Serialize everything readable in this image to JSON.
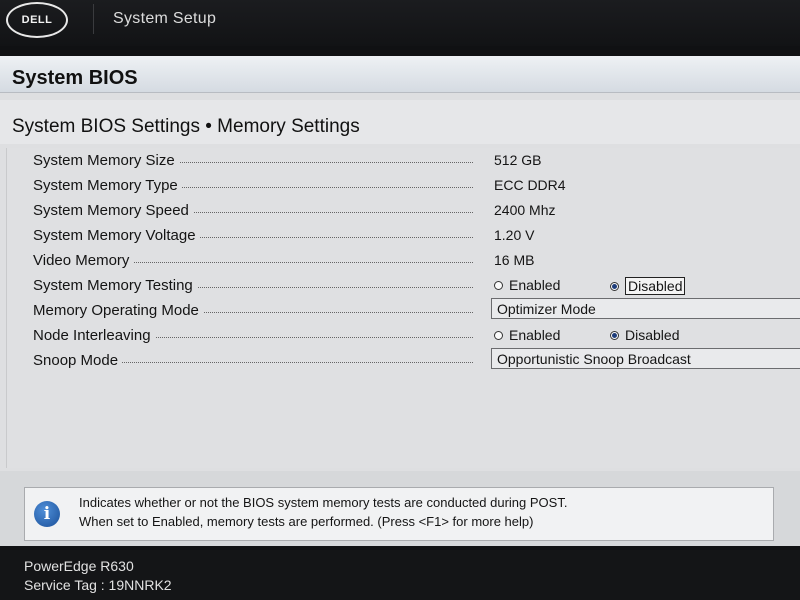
{
  "header": {
    "logo_text": "DELL",
    "app_title": "System Setup"
  },
  "section": {
    "title": "System BIOS"
  },
  "page": {
    "title": "System BIOS Settings • Memory Settings"
  },
  "settings": [
    {
      "label": "System Memory Size",
      "value": "512 GB"
    },
    {
      "label": "System Memory Type",
      "value": "ECC DDR4"
    },
    {
      "label": "System Memory Speed",
      "value": "2400 Mhz"
    },
    {
      "label": "System Memory Voltage",
      "value": "1.20 V"
    },
    {
      "label": "Video Memory",
      "value": "16 MB"
    },
    {
      "label": "System Memory Testing",
      "options": [
        "Enabled",
        "Disabled"
      ],
      "selected": "Disabled"
    },
    {
      "label": "Memory Operating Mode",
      "value": "Optimizer Mode"
    },
    {
      "label": "Node Interleaving",
      "options": [
        "Enabled",
        "Disabled"
      ],
      "selected": "Disabled"
    },
    {
      "label": "Snoop Mode",
      "value": "Opportunistic Snoop Broadcast"
    }
  ],
  "help": {
    "icon": "info-icon",
    "line1": "Indicates whether or not the BIOS system memory tests are conducted during POST.",
    "line2": "When set to Enabled, memory tests are performed. (Press <F1> for more help)"
  },
  "footer": {
    "model": "PowerEdge R630",
    "service_tag": "Service Tag : 19NNRK2"
  },
  "colors": {
    "header_bg": "#121315",
    "panel_bg": "#dfe0e2",
    "info_icon": "#1a4f98"
  }
}
